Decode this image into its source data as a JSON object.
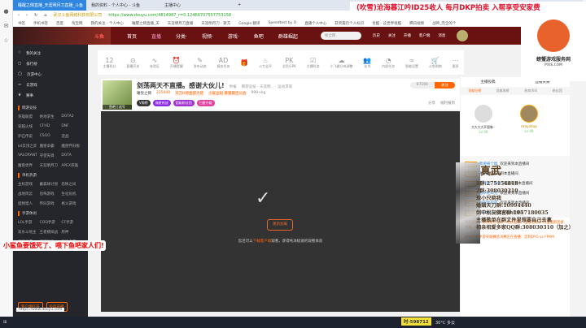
{
  "browser": {
    "tabs": [
      "睡醒之侧直播_天涯明月刀直播_斗鱼",
      "我的资料 - 个人中心 - 斗鱼",
      "主播中心"
    ],
    "address_site": "武汉斗鱼网络科技有限公司",
    "url": "https://www.douyu.com/4814987_r=0.12466707557753158",
    "bookmarks": [
      "书签",
      "手机书签",
      "百度",
      "淘宝网",
      "我的关注 - 个人中心",
      "睡醒之侧直播_天",
      "天涯明月刀直播",
      "天涯明月刀 - 斯方",
      "Google 翻译",
      "Speedtest by O",
      "直播个人中心",
      "获奖履历个人标识",
      "优酷 - 这世界很酷",
      "腾讯视频",
      "战神_完全的个"
    ]
  },
  "header": {
    "nav": [
      "首页",
      "直播",
      "分类·",
      "视频·",
      "游戏·",
      "鱼吧",
      "群雄崛起"
    ],
    "search_placeholder": "搜全网",
    "icons": [
      "历史",
      "关注",
      "开播",
      "客户端",
      "消息"
    ]
  },
  "left_panel": {
    "items": [
      "我的关注",
      "排行榜",
      "页游中心",
      "云游戏",
      "赛事"
    ],
    "sections": [
      {
        "title": "网游竞技",
        "games": [
          "英雄联盟",
          "绝地求生",
          "DOTA2",
          "穿越火线",
          "CFHD",
          "DNF",
          "炉石传说",
          "CSGO",
          "逆战",
          "lol云顶之弈",
          "魔兽争霸",
          "魔兽怀旧服",
          "VALORANT",
          "守望先锋",
          "DOTA",
          "魔兽世界",
          "天涯明月刀",
          "APEX英雄"
        ]
      },
      {
        "title": "单机热游",
        "games": [
          "主机游戏",
          "戴森球计划",
          "恐怖之间",
          "战地风云",
          "恐怖游戏",
          "生化危机",
          "怪物猎人",
          "怀旧游戏",
          "格斗游戏"
        ]
      },
      {
        "title": "手游休闲",
        "games": [
          "LOL手游",
          "COD手游",
          "CF手游",
          "双乐斗地主",
          "王者模拟战",
          "原神",
          "天刀手游",
          "棋牌娱乐",
          "天谕手游"
        ]
      }
    ],
    "buttons": [
      "客户端打开",
      "投屏开播"
    ]
  },
  "toolbar": [
    {
      "v": "12",
      "l": "主播积分"
    },
    {
      "v": "⊙",
      "l": "直播开关"
    },
    {
      "v": "∿",
      "l": "体验区"
    },
    {
      "v": "⏰",
      "l": "开播提醒"
    },
    {
      "v": "✎",
      "l": "发布动态"
    },
    {
      "v": "AD",
      "l": "服务任务"
    },
    {
      "v": "🎁",
      "l": ""
    },
    {
      "v": "♨",
      "l": "火力全开"
    },
    {
      "v": "PK",
      "l": "全民乐PK"
    },
    {
      "v": "☑",
      "l": "主播任务"
    },
    {
      "v": "☁",
      "l": "小飞碟分成调整"
    },
    {
      "v": "👥",
      "l": "友邻"
    },
    {
      "v": "◔",
      "l": "内部任务"
    },
    {
      "v": "∞",
      "l": "智能设置"
    },
    {
      "v": "🛒",
      "l": "斗鱼购物"
    },
    {
      "v": "⋯",
      "l": "更多"
    }
  ],
  "stream": {
    "title": "剑荡两天不直播。感谢大伙儿!",
    "category": "举报",
    "path": "网游竞技 · 天涯明... · 运动求瑕",
    "streamer": "睡觉之侧",
    "hot": "225440",
    "tag1": "天刀H修金部大佬",
    "tag2": "小鲨豆斑  寨蜜最佳公会",
    "weight": "999+kg",
    "follow_count": "67166",
    "follow": "关注",
    "avatar_caption": "鱼吧 | 送号",
    "share": "分享",
    "report": "福利报到",
    "badges": [
      "V周榜",
      "福星热战",
      "超级粉丝团",
      "扫星升级"
    ]
  },
  "player": {
    "reload": "重新加载",
    "hint": "您还可以",
    "hint_link": "下载客户端",
    "hint_tail": "观看，获得纯净极速的观看体验"
  },
  "right_panel": {
    "links": [
      "主播投稿",
      "直播贡赛"
    ],
    "tabs": [
      "贡献日榜",
      "贡献周榜",
      "贵宾(64)",
      "粉丝团"
    ],
    "top_users": [
      {
        "name": "大大大大开图像~",
        "lv": "Lv 49"
      },
      {
        "name": "mayatop",
        "lv": "Lv 49"
      }
    ],
    "chat": [
      {
        "lv": "LV 26",
        "name": "我要躺个瘦",
        "msg": "欢迎来到本直播间"
      },
      {
        "lv": "LV 16",
        "name": "无语",
        "msg": "欢迎来到本直播间"
      },
      {
        "lv": "LV 14",
        "name": "二月红、Red",
        "msg": "欢迎来到本直播间"
      },
      {
        "lv": "LV 22",
        "name": "看水轻山无",
        "msg": "欢迎来到本直播间"
      },
      {
        "lv": "LV 21",
        "name": "为欢欢欢欢",
        "msg": "欢迎来到本直播间"
      },
      {
        "lv": "LV 26",
        "name": "Elotion",
        "msg": "欢迎来到本直播间"
      }
    ],
    "system1": "消息提醒：您的账号在另一地点登录，连接已断开 点击重新连接弹幕",
    "system2": "便命召唤手游天联赛总决赛正在直播：流到DYG vs FPXM"
  },
  "overlays": {
    "top_banner": "(吹雪)沧海暮江吟ID25收人 每月DKP拍卖 入帮享受安家费",
    "crab_text": "螃蟹游戏服务网",
    "crab_sub": "PXIE.COM",
    "left_banner": "小鲨鱼要饿死了、喂下鱼吧家人们!",
    "zhenwu": "真武",
    "qq_lines": [
      "1群:275154818",
      "2群:308030310",
      "现小只晓我",
      "婚姻天刀群:10994440",
      "剑中松友佛言群:1057180035",
      "主播歌单在群文件里想要自己去拿",
      "相亲相爱多家QQ群:308030310（加之）"
    ]
  },
  "taskbar": {
    "room": "时-598712",
    "weather": "30°C 多云",
    "url_status": "https://www.douyu.com"
  }
}
